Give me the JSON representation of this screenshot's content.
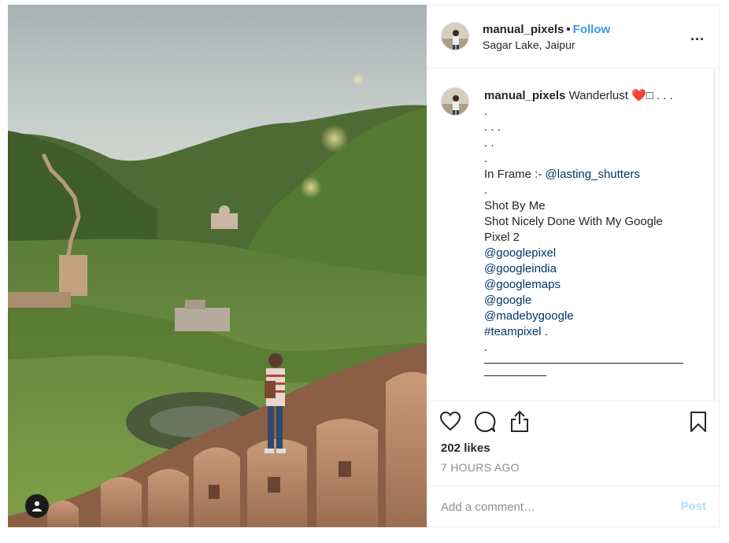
{
  "post": {
    "photo_icon": "person-icon",
    "accent_color": "#3897f0"
  },
  "header": {
    "username": "manual_pixels",
    "separator": "•",
    "follow_label": "Follow",
    "location": "Sagar Lake, Jaipur",
    "more_label": "...",
    "more_icon": "more-dots-icon"
  },
  "caption": {
    "username": "manual_pixels",
    "text": "Wanderlust",
    "emoji_heart": "❤️",
    "emoji_box": "□",
    "tail": ". . .",
    "dot1": ".",
    "dots3": ". . .",
    "dots2": ". .",
    "dot2": ".",
    "in_frame_label": "In Frame :-",
    "in_frame_mention": "@lasting_shutters",
    "dot3": ".",
    "shot_by": "Shot By Me",
    "shot_nicely_line1": "Shot Nicely Done With My Google",
    "shot_nicely_line2": "Pixel 2",
    "tags": [
      "@googlepixel",
      "@googleindia",
      "@googlemaps",
      "@google",
      "@madebygoogle"
    ],
    "hashtag": "#teampixel",
    "hashtag_suffix": " .",
    "dot4": "."
  },
  "actions": {
    "like_icon": "heart-icon",
    "comment_icon": "comment-bubble-icon",
    "share_icon": "share-icon",
    "save_icon": "bookmark-icon",
    "likes": "202 likes",
    "time": "7 HOURS AGO"
  },
  "comment": {
    "placeholder": "Add a comment…",
    "post_label": "Post",
    "post_color": "#b2dffc"
  }
}
